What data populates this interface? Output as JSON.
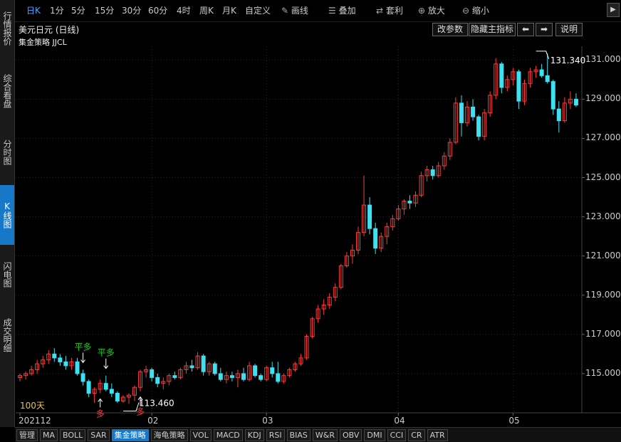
{
  "sidebar": {
    "tabs": [
      {
        "label": "行情报价",
        "active": false
      },
      {
        "label": "综合看盘",
        "active": false
      },
      {
        "label": "分时图",
        "active": false
      },
      {
        "label": "K线图",
        "active": true
      },
      {
        "label": "闪电图",
        "active": false
      },
      {
        "label": "成交明细",
        "active": false
      }
    ]
  },
  "toolbar": {
    "periods": [
      "日K",
      "1分",
      "5分",
      "15分",
      "30分",
      "60分",
      "4时",
      "周K",
      "月K",
      "自定义"
    ],
    "active_period": "日K",
    "tools": [
      {
        "icon": "pencil-icon",
        "label": "画线"
      },
      {
        "icon": "layers-icon",
        "label": "叠加"
      },
      {
        "icon": "arbitrage-icon",
        "label": "套利"
      },
      {
        "icon": "zoom-in-icon",
        "label": "放大"
      },
      {
        "icon": "zoom-out-icon",
        "label": "缩小"
      }
    ]
  },
  "chart_header": {
    "title": "美元日元 (日线)",
    "subtitle": "集金策略 JJCL",
    "buttons": {
      "modify_params": "改参数",
      "hide_main_indicator": "隐藏主指标",
      "explain": "说明"
    }
  },
  "days_label": "100天",
  "bottom_tabs": [
    "管理",
    "MA",
    "BOLL",
    "SAR",
    "集金策略",
    "海龟策略",
    "VOL",
    "MACD",
    "KDJ",
    "RSI",
    "BIAS",
    "W&R",
    "OBV",
    "DMI",
    "CCI",
    "CR",
    "ATR"
  ],
  "active_bottom_tab": "集金策略",
  "colors": {
    "up": "#ff3b3b",
    "down": "#3fe0f0",
    "signal_buy": "#ff3b3b",
    "signal_flat": "#22cc22",
    "accent": "#1778c8"
  },
  "chart_data": {
    "type": "candlestick",
    "title": "美元日元 (日线)",
    "y_ticks": [
      "115.000",
      "117.000",
      "119.000",
      "121.000",
      "123.000",
      "125.000",
      "127.000",
      "129.000",
      "131.000"
    ],
    "ylim": [
      113.0,
      131.7
    ],
    "x_labels": [
      {
        "index": 0,
        "label": "202112"
      },
      {
        "index": 23,
        "label": "02"
      },
      {
        "index": 43,
        "label": "03"
      },
      {
        "index": 66,
        "label": "04"
      },
      {
        "index": 86,
        "label": "05"
      }
    ],
    "annotations": [
      {
        "type": "low",
        "index": 20,
        "value": "113.460"
      },
      {
        "type": "high",
        "index": 92,
        "value": "131.340"
      }
    ],
    "signals": [
      {
        "index": 11,
        "label": "平多",
        "color": "flat"
      },
      {
        "index": 15,
        "label": "平多",
        "color": "flat"
      },
      {
        "index": 14,
        "label": "多",
        "color": "buy"
      },
      {
        "index": 21,
        "label": "多",
        "color": "buy"
      }
    ],
    "candles": [
      {
        "o": 114.8,
        "h": 115.0,
        "l": 114.6,
        "c": 114.9
      },
      {
        "o": 114.9,
        "h": 115.1,
        "l": 114.7,
        "c": 115.0
      },
      {
        "o": 115.0,
        "h": 115.4,
        "l": 114.9,
        "c": 115.2
      },
      {
        "o": 115.2,
        "h": 115.7,
        "l": 115.0,
        "c": 115.5
      },
      {
        "o": 115.5,
        "h": 115.9,
        "l": 115.3,
        "c": 115.7
      },
      {
        "o": 115.7,
        "h": 116.2,
        "l": 115.5,
        "c": 116.0
      },
      {
        "o": 116.0,
        "h": 116.3,
        "l": 115.6,
        "c": 115.8
      },
      {
        "o": 115.8,
        "h": 116.0,
        "l": 115.4,
        "c": 115.6
      },
      {
        "o": 115.6,
        "h": 115.9,
        "l": 115.2,
        "c": 115.4
      },
      {
        "o": 115.4,
        "h": 115.8,
        "l": 115.2,
        "c": 115.6
      },
      {
        "o": 115.6,
        "h": 115.8,
        "l": 114.9,
        "c": 115.0
      },
      {
        "o": 115.0,
        "h": 115.2,
        "l": 114.4,
        "c": 114.6
      },
      {
        "o": 114.6,
        "h": 114.7,
        "l": 113.8,
        "c": 114.0
      },
      {
        "o": 114.0,
        "h": 114.3,
        "l": 113.5,
        "c": 114.2
      },
      {
        "o": 114.2,
        "h": 114.7,
        "l": 114.0,
        "c": 114.5
      },
      {
        "o": 114.5,
        "h": 114.9,
        "l": 114.1,
        "c": 114.2
      },
      {
        "o": 114.2,
        "h": 114.5,
        "l": 113.8,
        "c": 114.0
      },
      {
        "o": 114.0,
        "h": 114.1,
        "l": 113.5,
        "c": 113.6
      },
      {
        "o": 113.6,
        "h": 113.9,
        "l": 113.5,
        "c": 113.8
      },
      {
        "o": 113.8,
        "h": 114.0,
        "l": 113.46,
        "c": 113.9
      },
      {
        "o": 113.9,
        "h": 114.4,
        "l": 113.6,
        "c": 114.3
      },
      {
        "o": 114.3,
        "h": 115.2,
        "l": 114.1,
        "c": 115.1
      },
      {
        "o": 115.1,
        "h": 115.4,
        "l": 114.8,
        "c": 115.2
      },
      {
        "o": 115.2,
        "h": 115.3,
        "l": 114.6,
        "c": 114.8
      },
      {
        "o": 114.8,
        "h": 115.0,
        "l": 114.3,
        "c": 114.5
      },
      {
        "o": 114.5,
        "h": 114.8,
        "l": 114.2,
        "c": 114.6
      },
      {
        "o": 114.6,
        "h": 115.0,
        "l": 114.4,
        "c": 114.9
      },
      {
        "o": 114.9,
        "h": 115.1,
        "l": 114.7,
        "c": 114.8
      },
      {
        "o": 114.8,
        "h": 115.3,
        "l": 114.7,
        "c": 115.2
      },
      {
        "o": 115.2,
        "h": 115.6,
        "l": 115.0,
        "c": 115.4
      },
      {
        "o": 115.4,
        "h": 115.7,
        "l": 115.1,
        "c": 115.3
      },
      {
        "o": 115.3,
        "h": 116.1,
        "l": 115.2,
        "c": 115.9
      },
      {
        "o": 115.9,
        "h": 116.0,
        "l": 114.9,
        "c": 115.1
      },
      {
        "o": 115.1,
        "h": 115.6,
        "l": 114.9,
        "c": 115.5
      },
      {
        "o": 115.5,
        "h": 115.6,
        "l": 114.9,
        "c": 115.0
      },
      {
        "o": 115.0,
        "h": 115.3,
        "l": 114.6,
        "c": 114.7
      },
      {
        "o": 114.7,
        "h": 115.1,
        "l": 114.5,
        "c": 114.9
      },
      {
        "o": 114.9,
        "h": 115.1,
        "l": 114.6,
        "c": 114.8
      },
      {
        "o": 114.8,
        "h": 115.2,
        "l": 114.3,
        "c": 115.0
      },
      {
        "o": 115.0,
        "h": 115.3,
        "l": 114.6,
        "c": 114.7
      },
      {
        "o": 114.7,
        "h": 115.6,
        "l": 114.6,
        "c": 115.4
      },
      {
        "o": 115.4,
        "h": 115.5,
        "l": 114.8,
        "c": 114.9
      },
      {
        "o": 114.9,
        "h": 115.0,
        "l": 114.6,
        "c": 114.7
      },
      {
        "o": 114.7,
        "h": 115.4,
        "l": 114.6,
        "c": 115.3
      },
      {
        "o": 115.3,
        "h": 115.6,
        "l": 114.8,
        "c": 115.0
      },
      {
        "o": 115.0,
        "h": 115.6,
        "l": 114.5,
        "c": 114.6
      },
      {
        "o": 114.6,
        "h": 115.0,
        "l": 114.5,
        "c": 114.9
      },
      {
        "o": 114.9,
        "h": 115.3,
        "l": 114.8,
        "c": 115.2
      },
      {
        "o": 115.2,
        "h": 115.6,
        "l": 115.1,
        "c": 115.5
      },
      {
        "o": 115.5,
        "h": 116.0,
        "l": 115.4,
        "c": 115.8
      },
      {
        "o": 115.8,
        "h": 117.0,
        "l": 115.7,
        "c": 116.9
      },
      {
        "o": 116.9,
        "h": 117.9,
        "l": 116.8,
        "c": 117.8
      },
      {
        "o": 117.8,
        "h": 118.5,
        "l": 117.6,
        "c": 118.3
      },
      {
        "o": 118.3,
        "h": 118.8,
        "l": 118.0,
        "c": 118.5
      },
      {
        "o": 118.5,
        "h": 119.1,
        "l": 118.3,
        "c": 118.9
      },
      {
        "o": 118.9,
        "h": 119.6,
        "l": 118.7,
        "c": 119.4
      },
      {
        "o": 119.4,
        "h": 120.6,
        "l": 119.3,
        "c": 120.5
      },
      {
        "o": 120.5,
        "h": 121.2,
        "l": 120.4,
        "c": 121.0
      },
      {
        "o": 121.0,
        "h": 121.6,
        "l": 120.6,
        "c": 121.3
      },
      {
        "o": 121.3,
        "h": 122.5,
        "l": 121.1,
        "c": 122.2
      },
      {
        "o": 122.2,
        "h": 125.1,
        "l": 122.0,
        "c": 123.6
      },
      {
        "o": 123.6,
        "h": 124.0,
        "l": 122.1,
        "c": 122.4
      },
      {
        "o": 122.4,
        "h": 122.7,
        "l": 121.1,
        "c": 121.4
      },
      {
        "o": 121.4,
        "h": 122.2,
        "l": 121.2,
        "c": 122.0
      },
      {
        "o": 122.0,
        "h": 122.7,
        "l": 121.6,
        "c": 122.5
      },
      {
        "o": 122.5,
        "h": 123.1,
        "l": 122.3,
        "c": 122.9
      },
      {
        "o": 122.9,
        "h": 123.6,
        "l": 122.8,
        "c": 123.4
      },
      {
        "o": 123.4,
        "h": 123.9,
        "l": 123.1,
        "c": 123.8
      },
      {
        "o": 123.8,
        "h": 124.1,
        "l": 123.4,
        "c": 123.7
      },
      {
        "o": 123.7,
        "h": 124.3,
        "l": 123.5,
        "c": 124.1
      },
      {
        "o": 124.1,
        "h": 125.3,
        "l": 124.0,
        "c": 125.1
      },
      {
        "o": 125.1,
        "h": 125.6,
        "l": 124.8,
        "c": 125.4
      },
      {
        "o": 125.4,
        "h": 125.6,
        "l": 124.9,
        "c": 125.1
      },
      {
        "o": 125.1,
        "h": 125.8,
        "l": 125.0,
        "c": 125.6
      },
      {
        "o": 125.6,
        "h": 126.3,
        "l": 125.4,
        "c": 126.1
      },
      {
        "o": 126.1,
        "h": 127.0,
        "l": 125.9,
        "c": 126.8
      },
      {
        "o": 126.8,
        "h": 129.1,
        "l": 126.7,
        "c": 128.8
      },
      {
        "o": 128.8,
        "h": 129.2,
        "l": 127.1,
        "c": 127.8
      },
      {
        "o": 127.8,
        "h": 128.9,
        "l": 127.6,
        "c": 128.6
      },
      {
        "o": 128.6,
        "h": 129.0,
        "l": 127.9,
        "c": 128.1
      },
      {
        "o": 128.1,
        "h": 128.2,
        "l": 126.9,
        "c": 127.1
      },
      {
        "o": 127.1,
        "h": 128.5,
        "l": 126.9,
        "c": 128.3
      },
      {
        "o": 128.3,
        "h": 129.4,
        "l": 128.1,
        "c": 129.2
      },
      {
        "o": 129.2,
        "h": 131.1,
        "l": 129.0,
        "c": 130.8
      },
      {
        "o": 130.8,
        "h": 130.9,
        "l": 129.3,
        "c": 129.6
      },
      {
        "o": 129.6,
        "h": 130.2,
        "l": 129.4,
        "c": 130.0
      },
      {
        "o": 130.0,
        "h": 130.6,
        "l": 129.7,
        "c": 130.4
      },
      {
        "o": 130.4,
        "h": 130.5,
        "l": 128.5,
        "c": 128.9
      },
      {
        "o": 128.9,
        "h": 130.0,
        "l": 128.7,
        "c": 129.8
      },
      {
        "o": 129.8,
        "h": 130.6,
        "l": 129.6,
        "c": 130.4
      },
      {
        "o": 130.4,
        "h": 130.7,
        "l": 130.1,
        "c": 130.5
      },
      {
        "o": 130.5,
        "h": 130.8,
        "l": 130.1,
        "c": 130.2
      },
      {
        "o": 130.2,
        "h": 131.34,
        "l": 129.8,
        "c": 129.9
      },
      {
        "o": 129.9,
        "h": 130.0,
        "l": 128.2,
        "c": 128.5
      },
      {
        "o": 128.5,
        "h": 128.9,
        "l": 127.3,
        "c": 127.9
      },
      {
        "o": 127.9,
        "h": 129.1,
        "l": 127.8,
        "c": 128.8
      },
      {
        "o": 128.8,
        "h": 129.4,
        "l": 128.5,
        "c": 129.0
      },
      {
        "o": 129.0,
        "h": 129.3,
        "l": 128.6,
        "c": 128.7
      }
    ]
  }
}
